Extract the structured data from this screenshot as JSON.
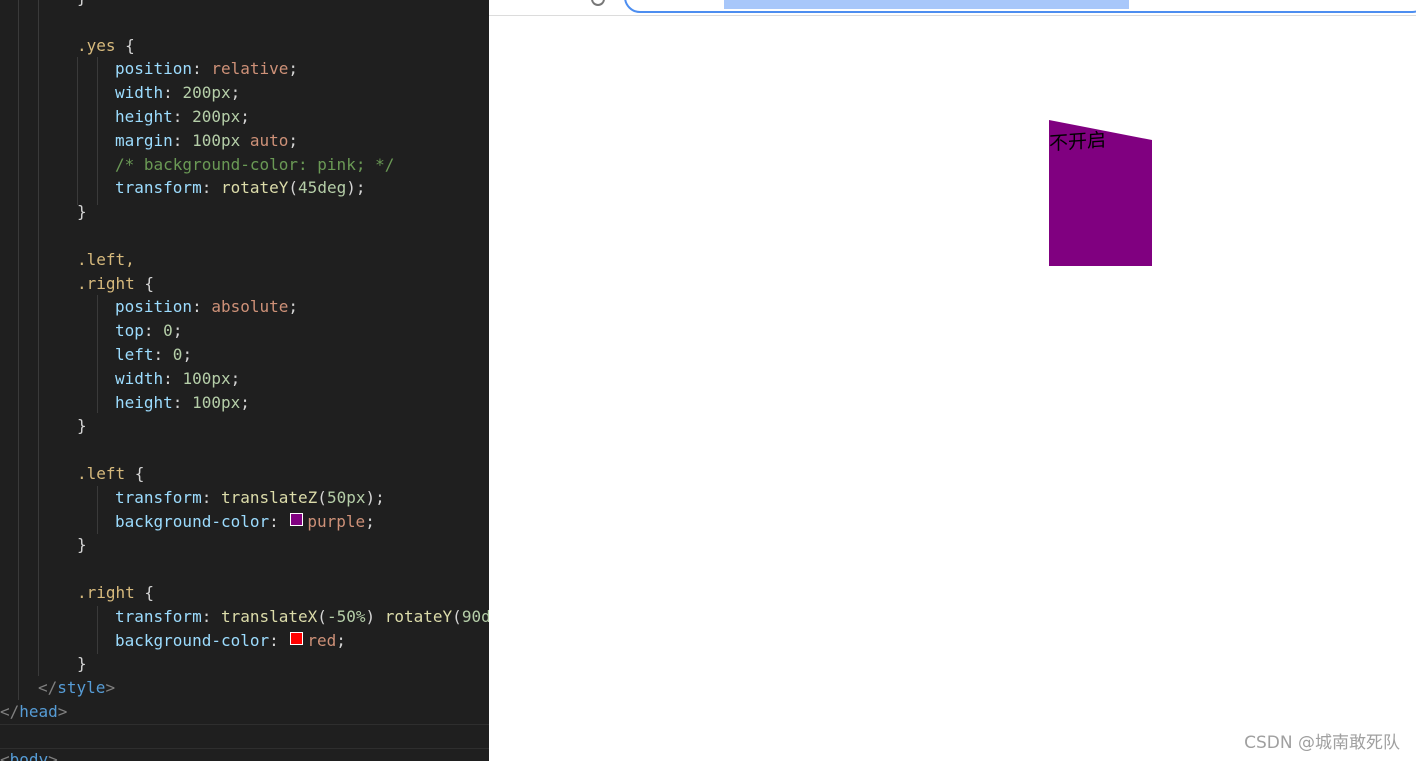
{
  "editor": {
    "lines": {
      "l01": "}",
      "l02": "",
      "l03_sel": ".yes",
      "l03_brace": " {",
      "l04_prop": "position",
      "l04_val": "relative",
      "l05_prop": "width",
      "l05_val": "200px",
      "l06_prop": "height",
      "l06_val": "200px",
      "l07_prop": "margin",
      "l07_val": "100px",
      "l07_kw": " auto",
      "l08_comment": "/* background-color: pink; */",
      "l09_prop": "transform",
      "l09_fn": "rotateY",
      "l09_val": "45deg",
      "l10": "}",
      "l11": "",
      "l12_sel": ".left,",
      "l13_sel": ".right",
      "l13_brace": " {",
      "l14_prop": "position",
      "l14_val": "absolute",
      "l15_prop": "top",
      "l15_val": "0",
      "l16_prop": "left",
      "l16_val": "0",
      "l17_prop": "width",
      "l17_val": "100px",
      "l18_prop": "height",
      "l18_val": "100px",
      "l19": "}",
      "l20": "",
      "l21_sel": ".left",
      "l21_brace": " {",
      "l22_prop": "transform",
      "l22_fn": "translateZ",
      "l22_val": "50px",
      "l23_prop": "background-color",
      "l23_val": "purple",
      "l24": "}",
      "l25": "",
      "l26_sel": ".right",
      "l26_brace": " {",
      "l27_prop": "transform",
      "l27_fn1": "translateX",
      "l27_val1": "-50%",
      "l27_fn2": "rotateY",
      "l27_val2": "90d",
      "l28_prop": "background-color",
      "l28_val": "red",
      "l29": "}",
      "l30_open": "</",
      "l30_tag": "style",
      "l30_close": ">",
      "l31_open": "</",
      "l31_tag": "head",
      "l31_close": ">",
      "l33_open": "<",
      "l33_tag": "body",
      "l33_close": ">"
    },
    "swatch_colors": {
      "purple": "#800080",
      "red": "#ff0000"
    }
  },
  "browser": {
    "box_label": "不开启",
    "box_color": "#800080",
    "watermark": "CSDN @城南敢死队"
  },
  "colors": {
    "editor_bg": "#1f1f1f",
    "address_focus": "#4d8ef0",
    "address_selection": "#a8c7fa"
  }
}
